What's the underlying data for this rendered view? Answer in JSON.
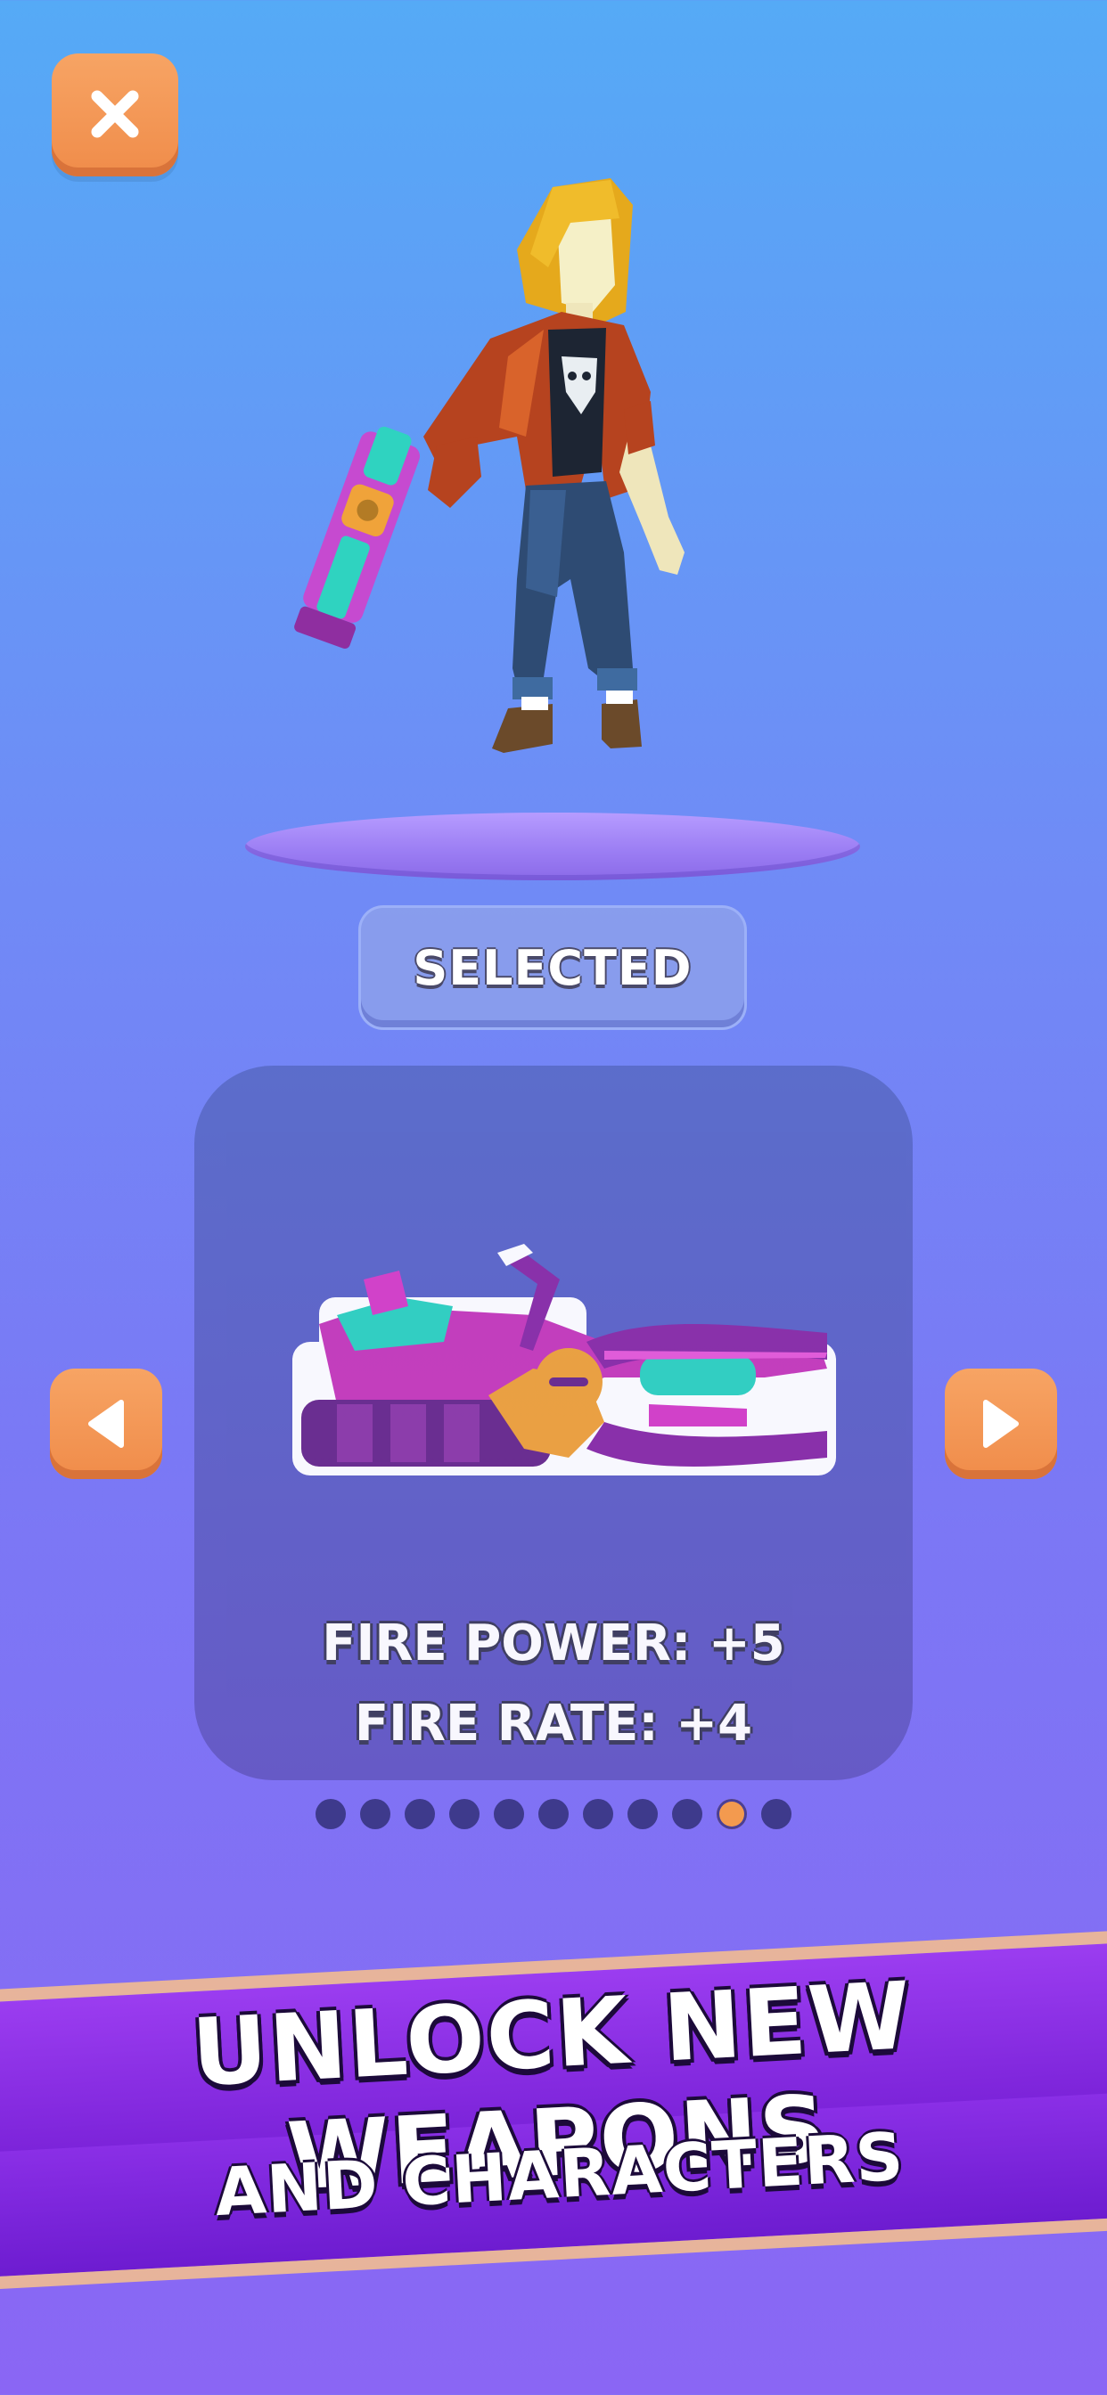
{
  "header": {
    "close_icon": "close-icon"
  },
  "character": {
    "icon": "character-figure"
  },
  "selection": {
    "status_label": "SELECTED"
  },
  "weapon": {
    "icon": "minigun-weapon",
    "stats": {
      "fire_power": "FIRE POWER: +5",
      "fire_rate": "FIRE RATE: +4"
    },
    "nav": {
      "prev_icon": "left-arrow-icon",
      "next_icon": "right-arrow-icon"
    }
  },
  "pagination": {
    "total": 11,
    "active_index": 9
  },
  "banner": {
    "line1": "UNLOCK NEW WEAPONS",
    "line2": "AND CHARACTERS"
  },
  "colors": {
    "accent_orange": "#f39a4f",
    "dot_inactive": "#3e3a8c",
    "banner_purple": "#8a2fe6"
  }
}
